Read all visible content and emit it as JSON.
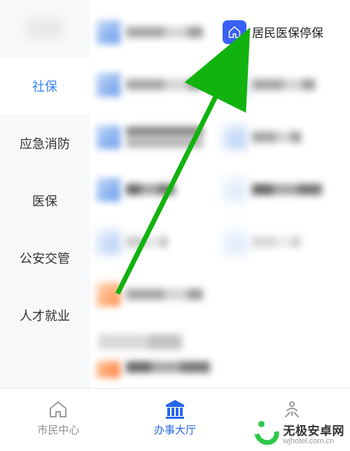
{
  "sidebar": {
    "items": [
      {
        "label": "",
        "blurry": true
      },
      {
        "label": "社保",
        "active": true
      },
      {
        "label": "应急消防"
      },
      {
        "label": "医保"
      },
      {
        "label": "公安交管"
      },
      {
        "label": "人才就业"
      }
    ]
  },
  "highlight_item": {
    "label": "居民医保停保",
    "icon": "house-icon"
  },
  "tabbar": {
    "items": [
      {
        "label": "市民中心",
        "icon": "home-icon"
      },
      {
        "label": "办事大厅",
        "icon": "gov-building-icon",
        "active": true
      },
      {
        "label": "",
        "icon": "person-icon"
      }
    ]
  },
  "watermark": {
    "title": "无极安卓网",
    "url": "wjhotel.com.cn"
  },
  "colors": {
    "accent": "#3b82f6",
    "arrow": "#12b30e",
    "highlight_bg": "#3760f4"
  }
}
